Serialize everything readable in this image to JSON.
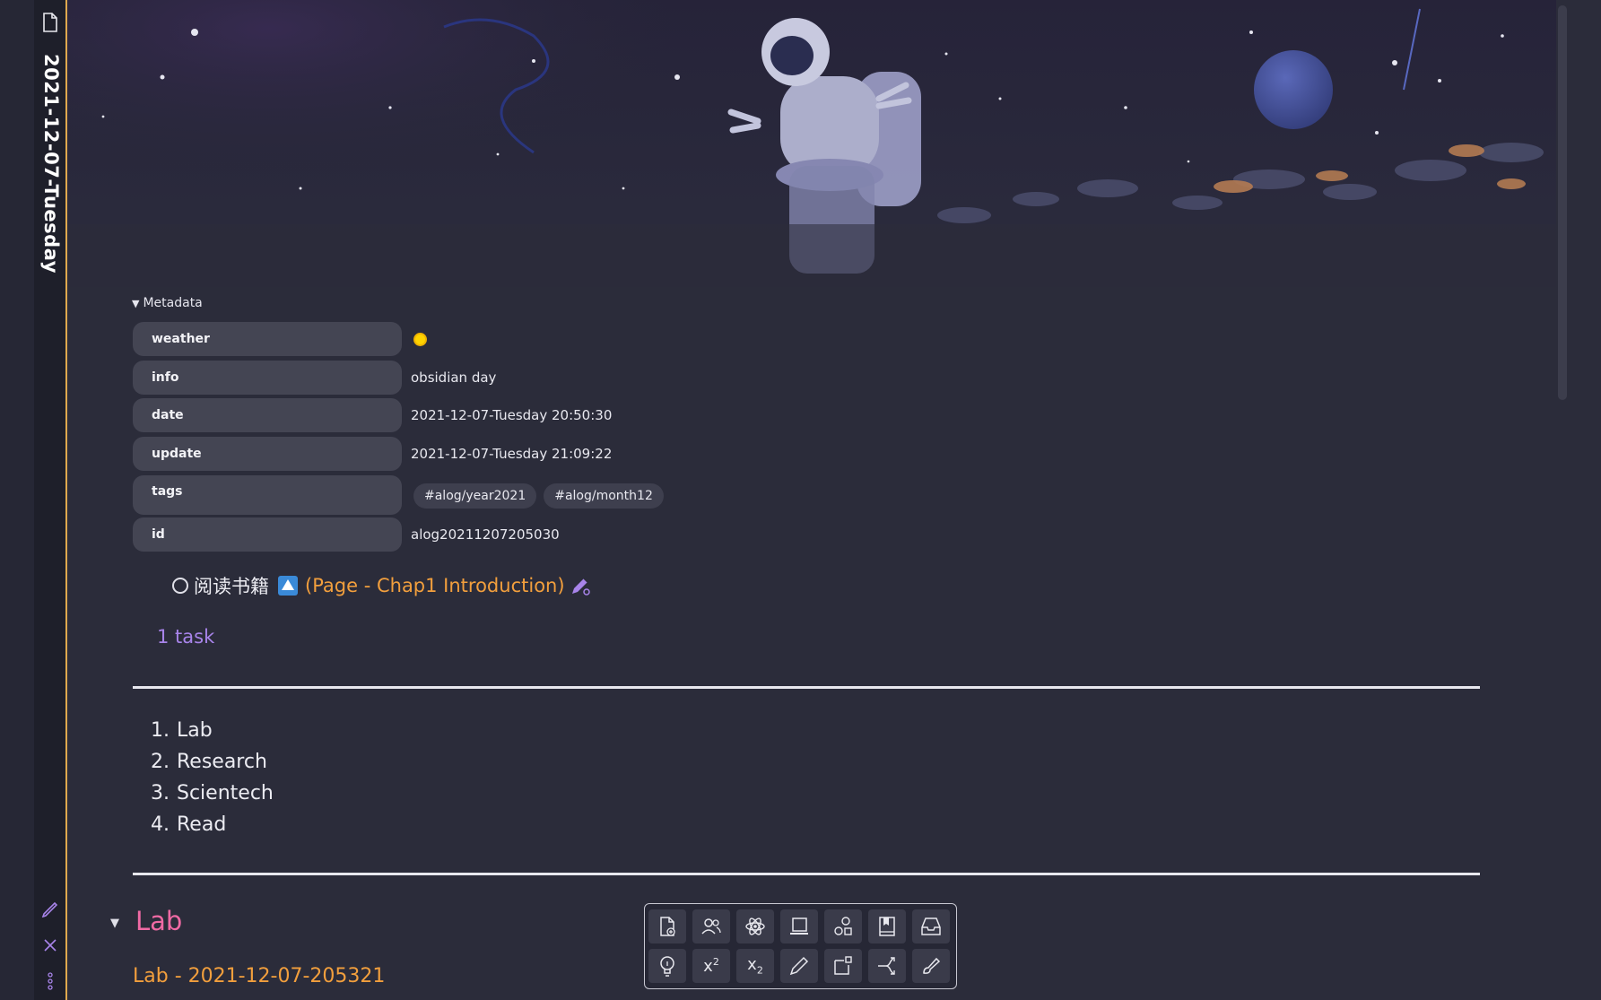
{
  "tab": {
    "title": "2021-12-07-Tuesday"
  },
  "metadata": {
    "toggle_label": "Metadata",
    "rows": [
      {
        "key": "weather",
        "value": ""
      },
      {
        "key": "info",
        "value": "obsidian day"
      },
      {
        "key": "date",
        "value": "2021-12-07-Tuesday 20:50:30"
      },
      {
        "key": "update",
        "value": "2021-12-07-Tuesday 21:09:22"
      },
      {
        "key": "tags",
        "value": ""
      },
      {
        "key": "id",
        "value": "alog20211207205030"
      }
    ],
    "tags": [
      "#alog/year2021",
      "#alog/month12"
    ]
  },
  "task": {
    "text": "阅读书籍",
    "open_paren": "(",
    "link": "Page - Chap1 Introduction",
    "close_paren": ")",
    "count": "1 task"
  },
  "list": [
    {
      "num": "1.",
      "label": "Lab"
    },
    {
      "num": "2.",
      "label": "Research"
    },
    {
      "num": "3.",
      "label": "Scientech"
    },
    {
      "num": "4.",
      "label": "Read"
    }
  ],
  "section": {
    "heading": "Lab",
    "subtitle": "Lab - 2021-12-07-205321"
  },
  "toolbar": {
    "superscript_label": "x",
    "superscript_mark": "2",
    "subscript_label": "x",
    "subscript_mark": "2",
    "icons_row1": [
      "new-file-icon",
      "people-icon",
      "atom-icon",
      "laptop-icon",
      "shapes-icon",
      "bookmark-book-icon",
      "inbox-icon"
    ],
    "icons_row2": [
      "lightbulb-icon",
      "superscript-icon",
      "subscript-icon",
      "pencil-icon",
      "frame-icon",
      "branch-icon",
      "brush-icon"
    ]
  },
  "colors": {
    "accent_orange": "#f29f3d",
    "heading_pink": "#f06aa4",
    "task_count_purple": "#a884ea",
    "tab_border": "#e0a94e",
    "weather_yellow": "#ffd400"
  }
}
